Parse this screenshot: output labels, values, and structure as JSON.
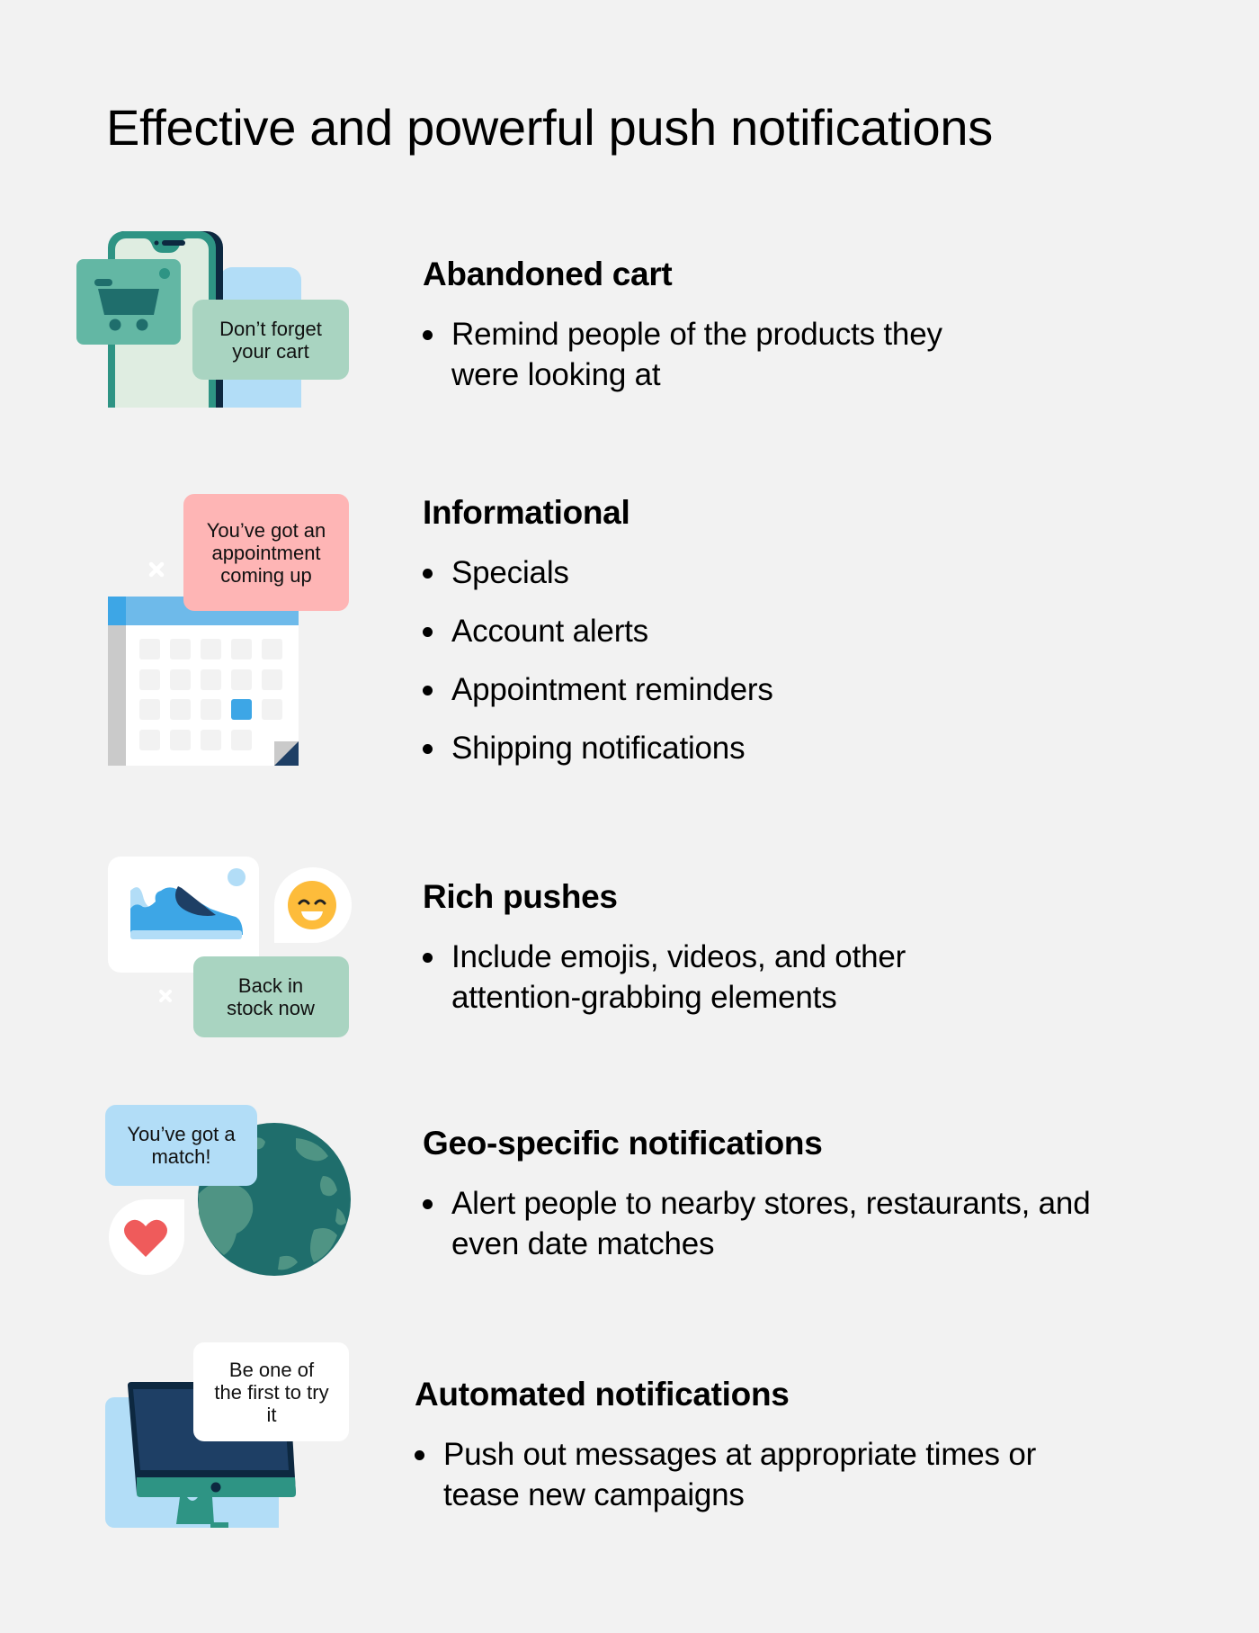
{
  "page": {
    "title": "Effective and powerful push notifications",
    "background_color": "#F2F2F2"
  },
  "sections": [
    {
      "heading": "Abandoned cart",
      "bullets": [
        "Remind people of the products they were looking at"
      ],
      "illustration": {
        "type": "phone-with-cart",
        "bubble_text": "Don’t forget your cart",
        "colors": {
          "phone_frame": "#2E9484",
          "phone_screen": "#DFEDE1",
          "cart_card": "#63B7A4",
          "cart": "#1F6E6C",
          "bubble": "#A9D4C1",
          "backdrop": "#B2DDF7",
          "phone_shadow": "#0D2840"
        }
      }
    },
    {
      "heading": "Informational",
      "bullets": [
        "Specials",
        "Account alerts",
        "Appointment reminders",
        "Shipping notifications"
      ],
      "illustration": {
        "type": "calendar",
        "bubble_text": "You’ve got an appointment coming up",
        "colors": {
          "bubble": "#FEB5B5",
          "header": "#6EBAEA",
          "header_tab": "#3DA6E6",
          "spine": "#CACACA",
          "highlight_day": "#3DA6E6",
          "day": "#F2F2F2",
          "corner": "#1E3F65"
        }
      }
    },
    {
      "heading": "Rich pushes",
      "bullets": [
        "Include emojis, videos, and other attention-grabbing elements"
      ],
      "illustration": {
        "type": "shoe-and-emoji",
        "bubble_text": "Back in stock now",
        "colors": {
          "bubble": "#A9D4C1",
          "shoe": "#3DA6E6",
          "shoe_light": "#B2DDF7",
          "shoe_dark": "#1E3F65",
          "emoji": "#FDBC3B"
        }
      }
    },
    {
      "heading": "Geo-specific notifications",
      "bullets": [
        "Alert people to nearby stores, restaurants, and even date matches"
      ],
      "illustration": {
        "type": "globe-and-heart",
        "bubble_text": "You’ve got a match!",
        "colors": {
          "bubble": "#B2DDF7",
          "globe_ocean": "#1F6E6C",
          "globe_land": "#4F9484",
          "heart": "#EF5B5B"
        }
      }
    },
    {
      "heading": "Automated notifications",
      "bullets": [
        "Push out messages at appropriate times or tease new campaigns"
      ],
      "illustration": {
        "type": "desktop-monitor",
        "bubble_text": "Be one of the first to try it",
        "colors": {
          "backdrop": "#B2DDF7",
          "bezel": "#0D2840",
          "screen": "#1E3F65",
          "chin": "#2E9484",
          "bubble": "#FFFFFF"
        }
      }
    }
  ]
}
